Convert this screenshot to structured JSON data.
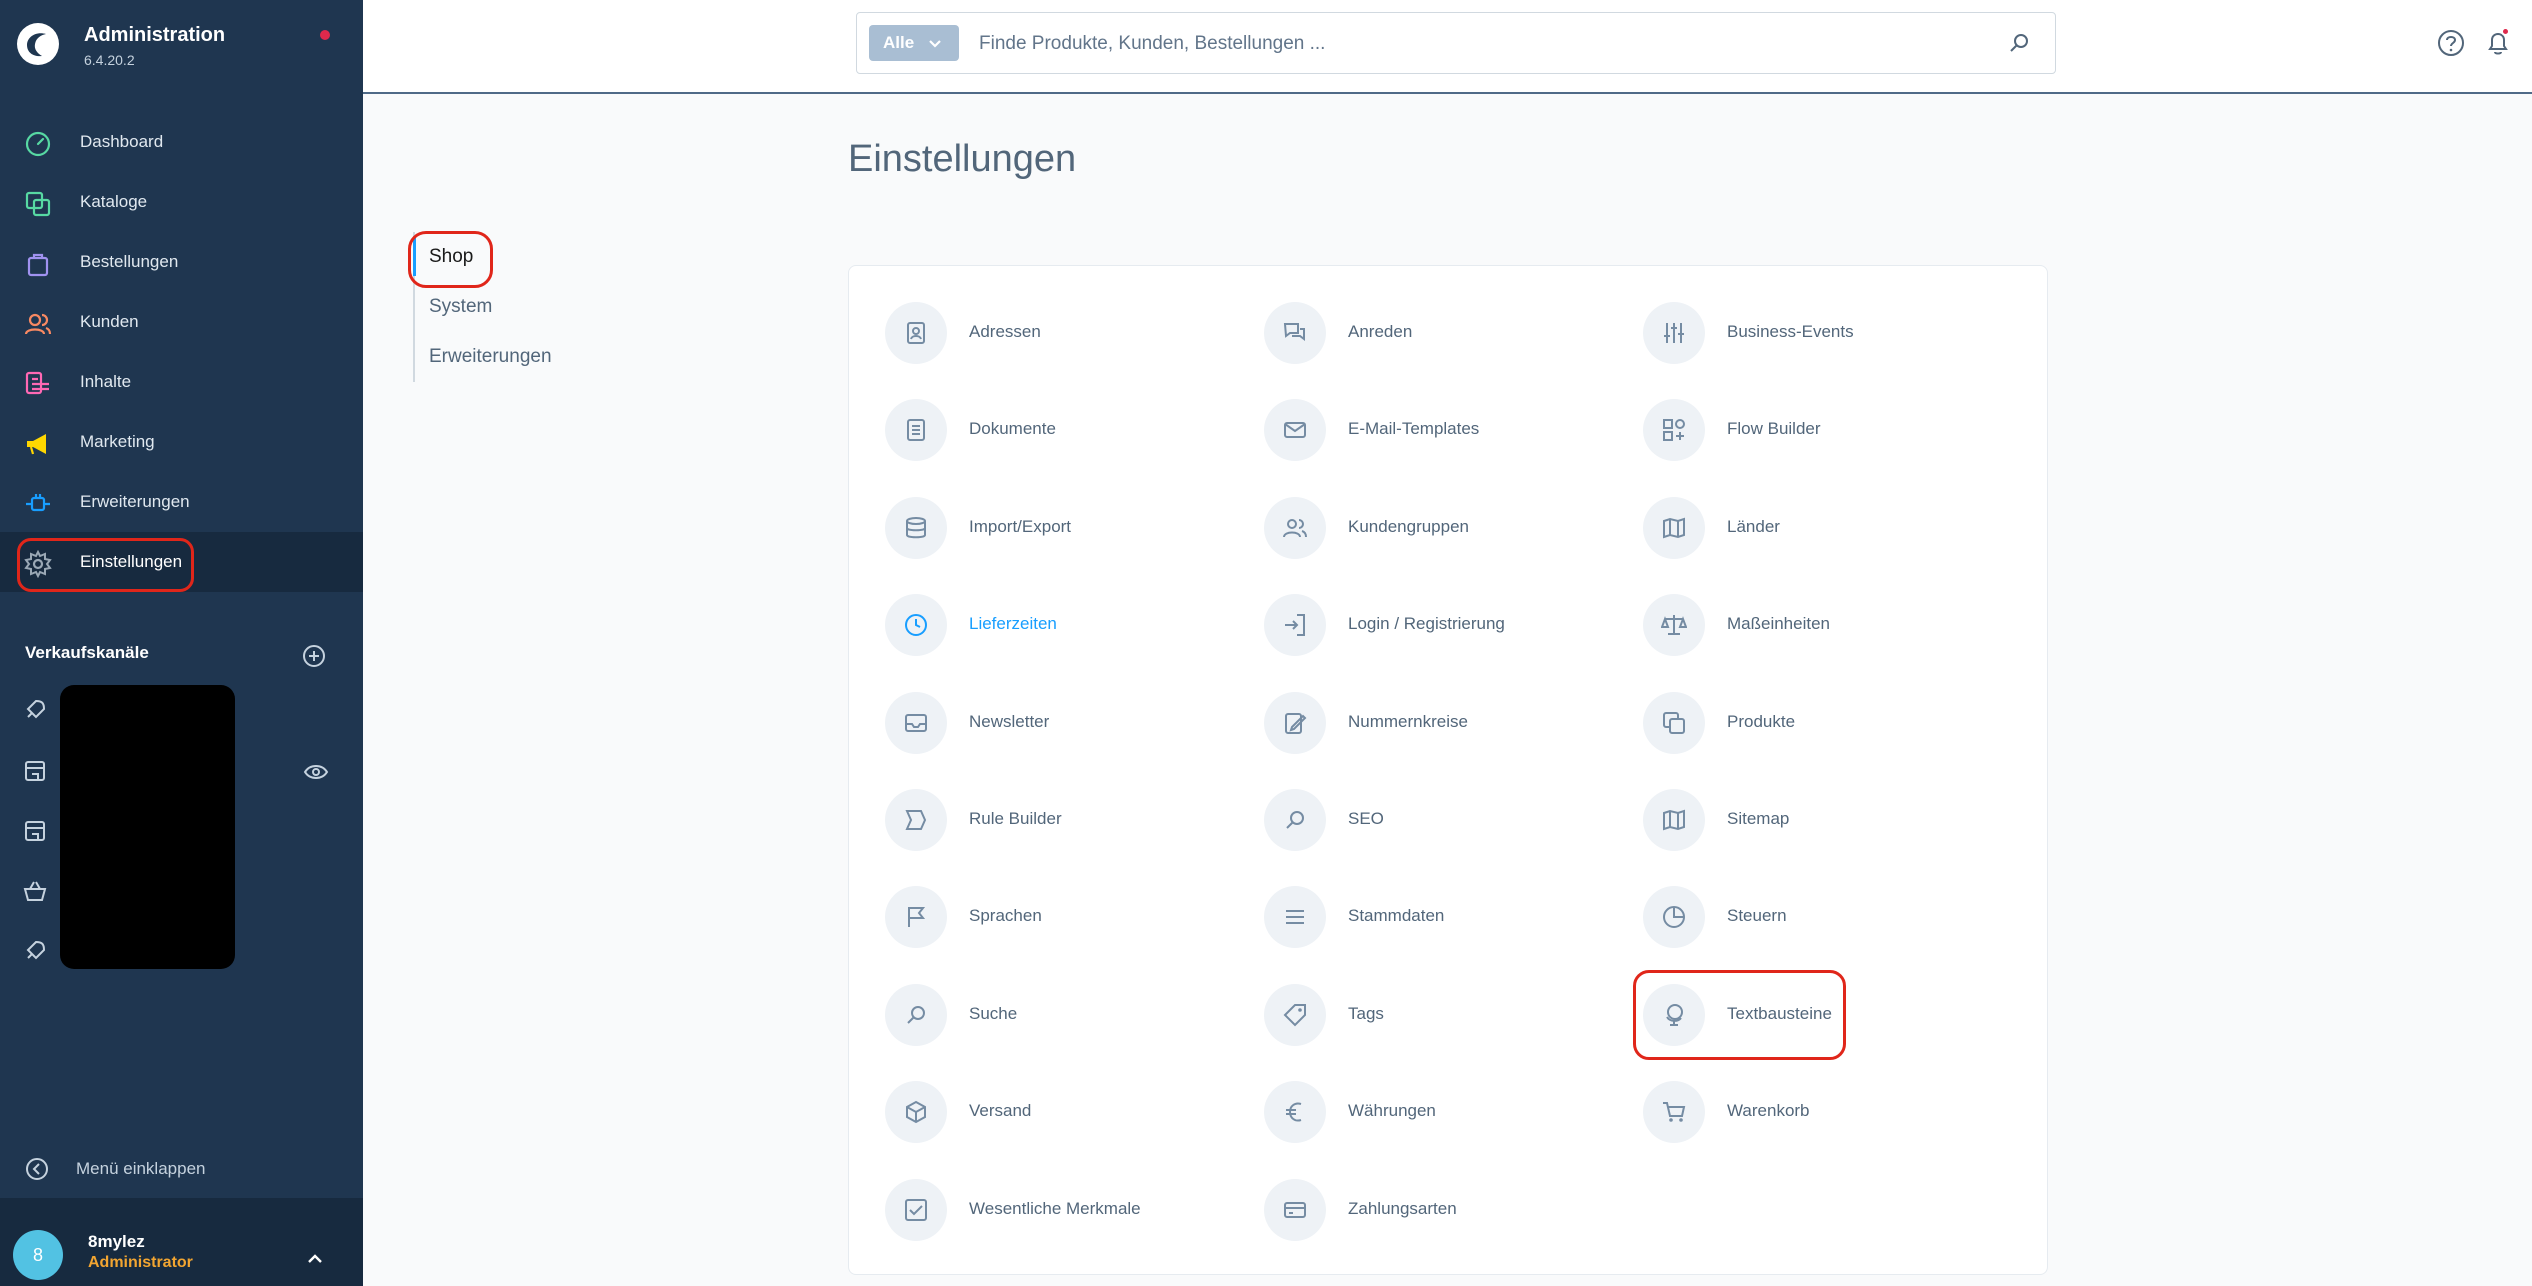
{
  "app": {
    "title": "Administration",
    "version": "6.4.20.2"
  },
  "nav": [
    {
      "label": "Dashboard",
      "icon": "dashboard-icon",
      "color": "#57d9a3"
    },
    {
      "label": "Kataloge",
      "icon": "catalog-icon",
      "color": "#57d9a3"
    },
    {
      "label": "Bestellungen",
      "icon": "bag-icon",
      "color": "#a092f0"
    },
    {
      "label": "Kunden",
      "icon": "users-icon",
      "color": "#f88962"
    },
    {
      "label": "Inhalte",
      "icon": "content-icon",
      "color": "#ff68b4"
    },
    {
      "label": "Marketing",
      "icon": "megaphone-icon",
      "color": "#ffd700"
    },
    {
      "label": "Erweiterungen",
      "icon": "plug-icon",
      "color": "#189eff"
    },
    {
      "label": "Einstellungen",
      "icon": "gear-icon",
      "color": "#9aa8b5"
    }
  ],
  "sales_channels": {
    "header": "Verkaufskanäle"
  },
  "collapse_label": "Menü einklappen",
  "user": {
    "initial": "8",
    "name": "8mylez",
    "role": "Administrator"
  },
  "search": {
    "type_label": "Alle",
    "placeholder": "Finde Produkte, Kunden, Bestellungen ..."
  },
  "page": {
    "title": "Einstellungen"
  },
  "tabs": [
    "Shop",
    "System",
    "Erweiterungen"
  ],
  "settings": [
    [
      "Adressen",
      "Anreden",
      "Business-Events"
    ],
    [
      "Dokumente",
      "E-Mail-Templates",
      "Flow Builder"
    ],
    [
      "Import/Export",
      "Kundengruppen",
      "Länder"
    ],
    [
      "Lieferzeiten",
      "Login / Registrierung",
      "Maßeinheiten"
    ],
    [
      "Newsletter",
      "Nummernkreise",
      "Produkte"
    ],
    [
      "Rule Builder",
      "SEO",
      "Sitemap"
    ],
    [
      "Sprachen",
      "Stammdaten",
      "Steuern"
    ],
    [
      "Suche",
      "Tags",
      "Textbausteine"
    ],
    [
      "Versand",
      "Währungen",
      "Warenkorb"
    ],
    [
      "Wesentliche Merkmale",
      "Zahlungsarten",
      ""
    ]
  ],
  "colors": {
    "sidebar": "#1f3650",
    "accent": "#189eff",
    "highlight": "#e0261a"
  }
}
